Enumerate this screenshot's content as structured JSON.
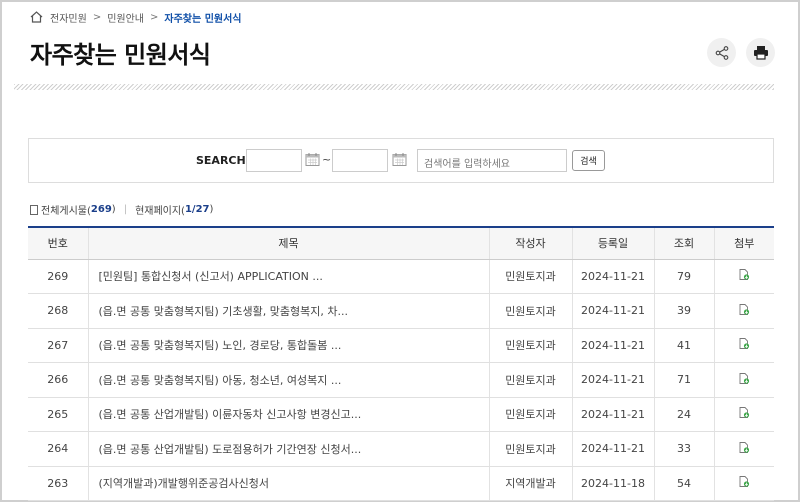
{
  "breadcrumb": {
    "items": [
      "전자민원",
      "민원안내",
      "자주찾는 민원서식"
    ],
    "separator": ">"
  },
  "page": {
    "title": "자주찾는 민원서식"
  },
  "search": {
    "label": "SEARCH",
    "tilde": "~",
    "placeholder": "검색어를 입력하세요",
    "button": "검색"
  },
  "summary": {
    "total_label": "전체게시물(",
    "total": "269",
    "close": ")",
    "page_label": "현재페이지(",
    "page": "1/27",
    "page_close": ")",
    "divider": "|"
  },
  "table": {
    "headers": [
      "번호",
      "제목",
      "작성자",
      "등록일",
      "조회",
      "첨부"
    ],
    "rows": [
      {
        "num": "269",
        "title": "[민원팀] 통합신청서 (신고서) APPLICATION ...",
        "author": "민원토지과",
        "date": "2024-11-21",
        "views": "79"
      },
      {
        "num": "268",
        "title": "(읍.면 공통 맞춤형복지팀) 기초생활, 맞춤형복지, 차...",
        "author": "민원토지과",
        "date": "2024-11-21",
        "views": "39"
      },
      {
        "num": "267",
        "title": "(읍.면 공통 맞춤형복지팀) 노인, 경로당, 통합돌봄 ...",
        "author": "민원토지과",
        "date": "2024-11-21",
        "views": "41"
      },
      {
        "num": "266",
        "title": "(읍.면 공통 맞춤형복지팀) 아동, 청소년, 여성복지 ...",
        "author": "민원토지과",
        "date": "2024-11-21",
        "views": "71"
      },
      {
        "num": "265",
        "title": "(읍.면 공통 산업개발팀) 이륜자동차 신고사항 변경신고...",
        "author": "민원토지과",
        "date": "2024-11-21",
        "views": "24"
      },
      {
        "num": "264",
        "title": "(읍.면 공통 산업개발팀) 도로점용허가 기간연장 신청서...",
        "author": "민원토지과",
        "date": "2024-11-21",
        "views": "33"
      },
      {
        "num": "263",
        "title": "(지역개발과)개발행위준공검사신청서",
        "author": "지역개발과",
        "date": "2024-11-18",
        "views": "54"
      }
    ]
  },
  "icons": {
    "home": "home-icon",
    "share": "share-icon",
    "print": "print-icon",
    "calendar": "calendar-icon",
    "attachment": "attachment-icon"
  },
  "colors": {
    "accent": "#1b3f8a",
    "breadcrumb_current": "#0f4fa8",
    "attach_green": "#3ea64a"
  }
}
